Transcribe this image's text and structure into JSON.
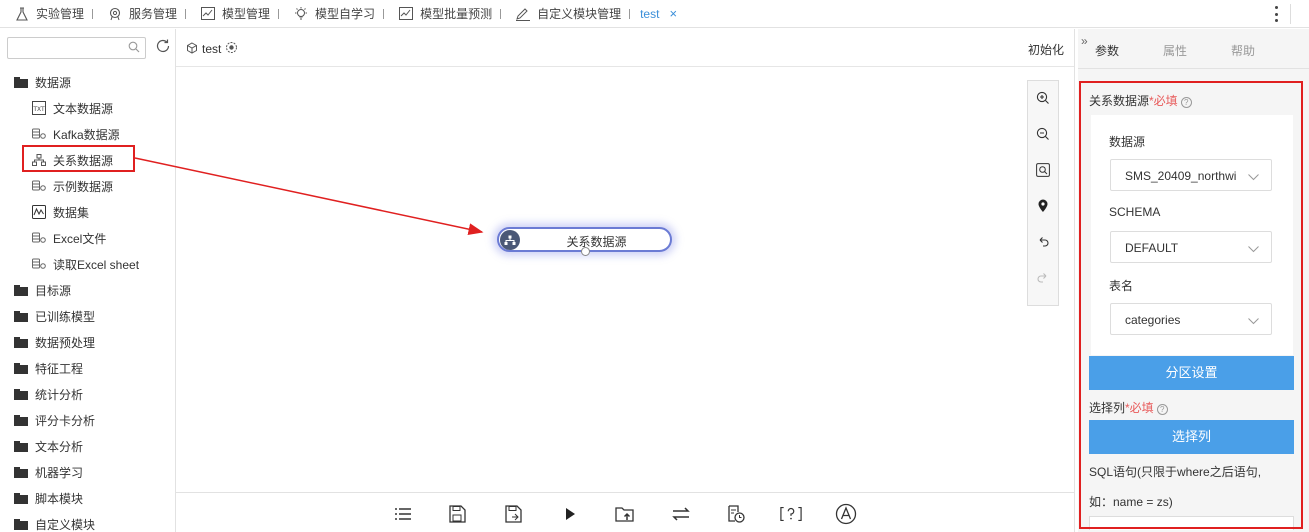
{
  "tabs": [
    {
      "label": "实验管理",
      "icon": "flask-icon"
    },
    {
      "label": "服务管理",
      "icon": "service-icon"
    },
    {
      "label": "模型管理",
      "icon": "chart-icon"
    },
    {
      "label": "模型自学习",
      "icon": "bulb-icon"
    },
    {
      "label": "模型批量预测",
      "icon": "chart-icon"
    },
    {
      "label": "自定义模块管理",
      "icon": "edit-icon"
    }
  ],
  "active_tab": {
    "label": "test",
    "close": "×"
  },
  "left": {
    "search_placeholder": "",
    "tree": [
      {
        "type": "folder",
        "label": "数据源"
      },
      {
        "type": "child",
        "label": "文本数据源",
        "icon": "text-source-icon"
      },
      {
        "type": "child",
        "label": "Kafka数据源",
        "icon": "db-icon"
      },
      {
        "type": "child",
        "label": "关系数据源",
        "icon": "relation-icon"
      },
      {
        "type": "child",
        "label": "示例数据源",
        "icon": "db-icon"
      },
      {
        "type": "child",
        "label": "数据集",
        "icon": "dataset-icon"
      },
      {
        "type": "child",
        "label": "Excel文件",
        "icon": "db-icon"
      },
      {
        "type": "child",
        "label": "读取Excel sheet",
        "icon": "db-icon"
      },
      {
        "type": "folder",
        "label": "目标源"
      },
      {
        "type": "folder",
        "label": "已训练模型"
      },
      {
        "type": "folder",
        "label": "数据预处理"
      },
      {
        "type": "folder",
        "label": "特征工程"
      },
      {
        "type": "folder",
        "label": "统计分析"
      },
      {
        "type": "folder",
        "label": "评分卡分析"
      },
      {
        "type": "folder",
        "label": "文本分析"
      },
      {
        "type": "folder",
        "label": "机器学习"
      },
      {
        "type": "folder",
        "label": "脚本模块"
      },
      {
        "type": "folder",
        "label": "自定义模块"
      }
    ]
  },
  "canvas": {
    "title": "test",
    "init_label": "初始化",
    "node_label": "关系数据源"
  },
  "right": {
    "tabs": [
      "参数",
      "属性",
      "帮助"
    ],
    "active_tab": "参数",
    "collapse": "»",
    "relation_source_label": "关系数据源",
    "required": "*必填",
    "datasource_label": "数据源",
    "datasource_value": "SMS_20409_northwi",
    "schema_label": "SCHEMA",
    "schema_value": "DEFAULT",
    "table_label": "表名",
    "table_value": "categories",
    "partition_button": "分区设置",
    "select_cols_label": "选择列",
    "select_cols_button": "选择列",
    "sql_label_line1": "SQL语句(只限于where之后语句,",
    "sql_label_line2": "如：name = zs)"
  },
  "colors": {
    "accent": "#4a9fe8",
    "highlight": "#e02020",
    "link": "#3b8fd9"
  }
}
